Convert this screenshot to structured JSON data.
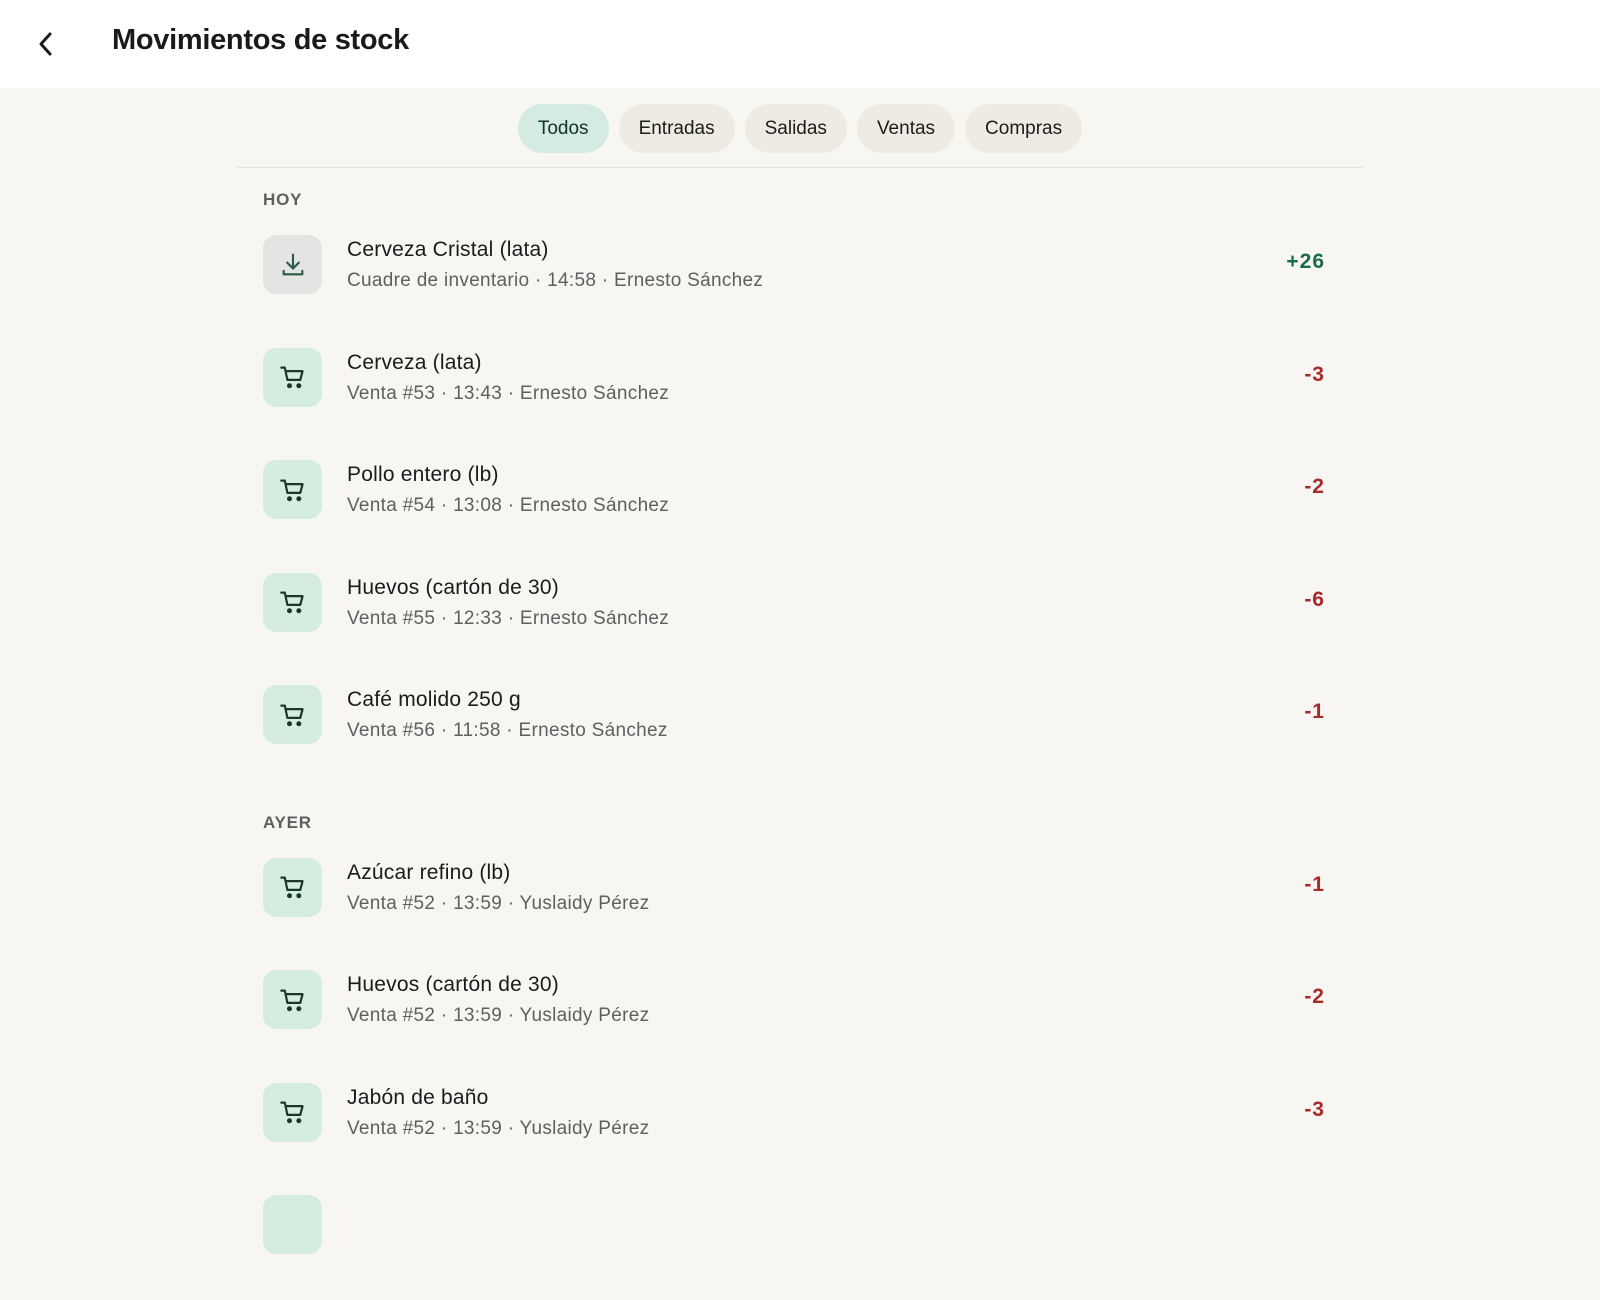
{
  "header": {
    "title": "Movimientos de stock",
    "back_icon": "chevron-left-icon"
  },
  "filters": [
    {
      "label": "Todos",
      "active": true
    },
    {
      "label": "Entradas",
      "active": false
    },
    {
      "label": "Salidas",
      "active": false
    },
    {
      "label": "Ventas",
      "active": false
    },
    {
      "label": "Compras",
      "active": false
    }
  ],
  "sections": [
    {
      "label": "HOY",
      "items": [
        {
          "icon": "download-icon",
          "name": "Cerveza Cristal (lata)",
          "meta": "Cuadre de inventario · 14:58 · Ernesto Sánchez",
          "qty": "+26",
          "direction": "in"
        },
        {
          "icon": "cart-icon",
          "name": "Cerveza (lata)",
          "meta": "Venta #53 · 13:43 · Ernesto Sánchez",
          "qty": "-3",
          "direction": "out"
        },
        {
          "icon": "cart-icon",
          "name": "Pollo entero (lb)",
          "meta": "Venta #54 · 13:08 · Ernesto Sánchez",
          "qty": "-2",
          "direction": "out"
        },
        {
          "icon": "cart-icon",
          "name": "Huevos (cartón de 30)",
          "meta": "Venta #55 · 12:33 · Ernesto Sánchez",
          "qty": "-6",
          "direction": "out"
        },
        {
          "icon": "cart-icon",
          "name": "Café molido 250 g",
          "meta": "Venta #56 · 11:58 · Ernesto Sánchez",
          "qty": "-1",
          "direction": "out"
        }
      ]
    },
    {
      "label": "AYER",
      "items": [
        {
          "icon": "cart-icon",
          "name": "Azúcar refino (lb)",
          "meta": "Venta #52 · 13:59 · Yuslaidy Pérez",
          "qty": "-1",
          "direction": "out"
        },
        {
          "icon": "cart-icon",
          "name": "Huevos (cartón de 30)",
          "meta": "Venta #52 · 13:59 · Yuslaidy Pérez",
          "qty": "-2",
          "direction": "out"
        },
        {
          "icon": "cart-icon",
          "name": "Jabón de baño",
          "meta": "Venta #52 · 13:59 · Yuslaidy Pérez",
          "qty": "-3",
          "direction": "out"
        }
      ]
    }
  ],
  "colors": {
    "accent_bg": "#d3ebe0",
    "positive": "#1b6b47",
    "negative": "#a82a2a",
    "page_bg": "#f8f6f2"
  }
}
